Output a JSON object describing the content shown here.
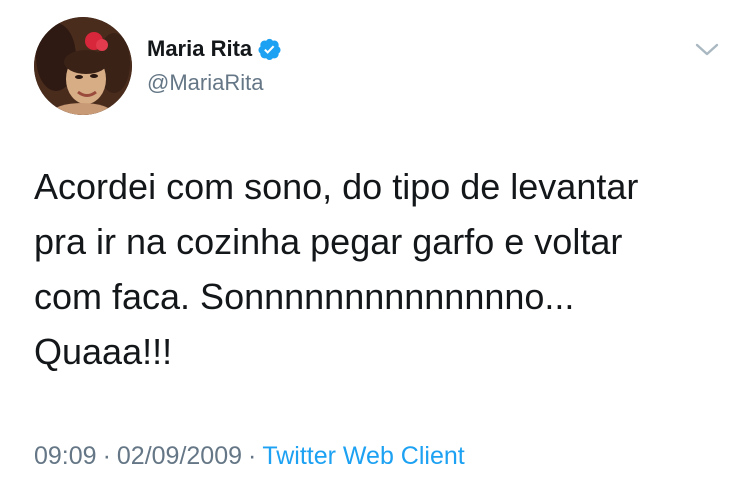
{
  "author": {
    "display_name": "Maria Rita",
    "handle": "@MariaRita",
    "verified": true
  },
  "tweet": {
    "lines": [
      "Acordei com sono, do tipo de levantar",
      "pra ir na cozinha pegar garfo e voltar",
      "com faca. Sonnnnnnnnnnnnnno...",
      "Quaaa!!!"
    ]
  },
  "meta": {
    "time": "09:09",
    "separator": "·",
    "date": "02/09/2009",
    "client": "Twitter Web Client"
  },
  "icons": {
    "verified": "verified-badge-icon",
    "menu": "chevron-down-icon"
  },
  "colors": {
    "text_primary": "#14171a",
    "text_secondary": "#657786",
    "accent": "#1da1f2"
  }
}
